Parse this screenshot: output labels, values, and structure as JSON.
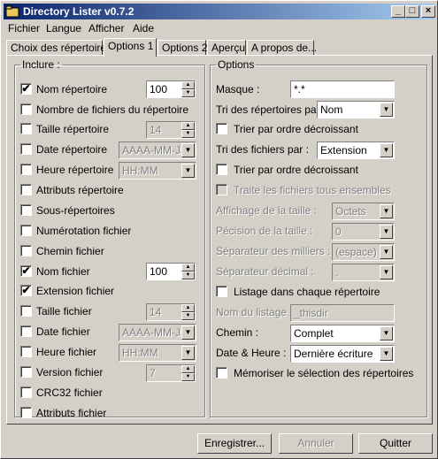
{
  "window": {
    "title": "Directory Lister v0.7.2"
  },
  "menu": [
    "Fichier",
    "Langue",
    "Afficher",
    "Aide"
  ],
  "tabs": [
    "Choix des répertoires",
    "Options 1",
    "Options 2",
    "Aperçu",
    "A propos de..."
  ],
  "inclure": {
    "legend": "Inclure :",
    "items": [
      {
        "label": "Nom répertoire",
        "checked": "✔",
        "value": "100"
      },
      {
        "label": "Nombre de fichiers du répertoire",
        "checked": ""
      },
      {
        "label": "Taille répertoire",
        "checked": "",
        "value": "14"
      },
      {
        "label": "Date répertoire",
        "checked": "",
        "value": "AAAA-MM-JJ"
      },
      {
        "label": "Heure répertoire",
        "checked": "",
        "value": "HH:MM"
      },
      {
        "label": "Attributs répertoire",
        "checked": ""
      },
      {
        "label": "Sous-répertoires",
        "checked": ""
      },
      {
        "label": "Numérotation fichier",
        "checked": ""
      },
      {
        "label": "Chemin fichier",
        "checked": ""
      },
      {
        "label": "Nom fichier",
        "checked": "✔",
        "value": "100"
      },
      {
        "label": "Extension fichier",
        "checked": "✔"
      },
      {
        "label": "Taille fichier",
        "checked": "",
        "value": "14"
      },
      {
        "label": "Date fichier",
        "checked": "",
        "value": "AAAA-MM-JJ"
      },
      {
        "label": "Heure fichier",
        "checked": "",
        "value": "HH:MM"
      },
      {
        "label": "Version fichier",
        "checked": "",
        "value": "7"
      },
      {
        "label": "CRC32 fichier",
        "checked": ""
      },
      {
        "label": "Attributs fichier",
        "checked": ""
      }
    ]
  },
  "options": {
    "legend": "Options",
    "masque_label": "Masque :",
    "masque_value": "*.*",
    "tri_rep_label": "Tri des répertoires par :",
    "tri_rep_value": "Nom",
    "tri_rep_desc": "Trier par ordre décroissant",
    "tri_fic_label": "Tri des fichiers par :",
    "tri_fic_value": "Extension",
    "tri_fic_desc": "Trier par ordre décroissant",
    "traite": "Traite les fichiers tous ensembles",
    "affichage_label": "Affichage de la taille :",
    "affichage_value": "Octets",
    "precision_label": "Pécision de la taille :",
    "precision_value": "0",
    "sep_milliers_label": "Séparateur des milliers :",
    "sep_milliers_value": "(espace)",
    "sep_decimal_label": "Séparateur décimal :",
    "sep_decimal_value": ".",
    "listage": "Listage dans chaque répertoire",
    "nom_listage_label": "Nom du listage :",
    "nom_listage_value": "_thisdir",
    "chemin_label": "Chemin :",
    "chemin_value": "Complet",
    "date_heure_label": "Date & Heure :",
    "date_heure_value": "Dernière écriture",
    "memoriser": "Mémoriser le sélection des répertoires"
  },
  "buttons": {
    "save": "Enregistrer...",
    "cancel": "Annuler",
    "quit": "Quitter"
  }
}
